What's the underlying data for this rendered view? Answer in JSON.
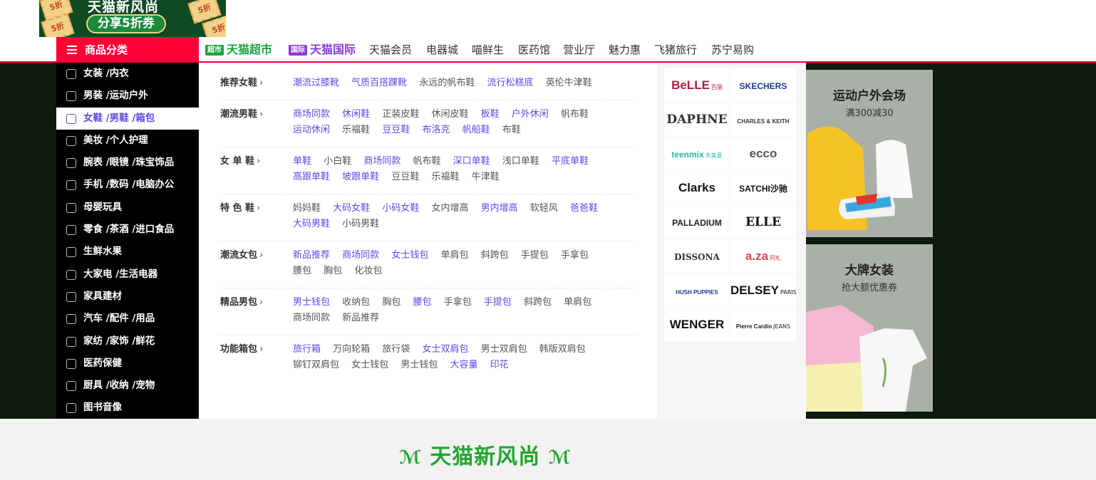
{
  "promo": {
    "title": "天猫新风尚",
    "coupon_text": "分享5折券",
    "coupon_badge": "5折"
  },
  "header": {
    "category_label": "商品分类",
    "nav": [
      {
        "label": "天猫超市",
        "badge": "超市",
        "color": "#1aa63d"
      },
      {
        "label": "天猫国际",
        "badge": "国际",
        "color": "#8d3bd8"
      },
      {
        "label": "天猫会员"
      },
      {
        "label": "电器城"
      },
      {
        "label": "喵鲜生"
      },
      {
        "label": "医药馆"
      },
      {
        "label": "营业厅"
      },
      {
        "label": "魅力惠"
      },
      {
        "label": "飞猪旅行"
      },
      {
        "label": "苏宁易购"
      }
    ]
  },
  "sidebar": {
    "items": [
      {
        "label": "女装 /内衣",
        "icon": "dress-icon"
      },
      {
        "label": "男装 /运动户外",
        "icon": "shirt-icon"
      },
      {
        "label": "女鞋 /男鞋 /箱包",
        "icon": "shoe-icon",
        "active": true
      },
      {
        "label": "美妆 /个人护理",
        "icon": "lipstick-icon"
      },
      {
        "label": "腕表 /眼镜 /珠宝饰品",
        "icon": "diamond-icon"
      },
      {
        "label": "手机 /数码 /电脑办公",
        "icon": "phone-icon"
      },
      {
        "label": "母婴玩具",
        "icon": "stroller-icon"
      },
      {
        "label": "零食 /茶酒 /进口食品",
        "icon": "food-icon"
      },
      {
        "label": "生鲜水果",
        "icon": "bike-icon"
      },
      {
        "label": "大家电 /生活电器",
        "icon": "fridge-icon"
      },
      {
        "label": "家具建材",
        "icon": "grid-icon"
      },
      {
        "label": "汽车 /配件 /用品",
        "icon": "car-icon"
      },
      {
        "label": "家纺 /家饰 /鲜花",
        "icon": "bed-icon"
      },
      {
        "label": "医药保健",
        "icon": "medicine-icon"
      },
      {
        "label": "厨具 /收纳 /宠物",
        "icon": "cup-icon"
      },
      {
        "label": "图书音像",
        "icon": "lock-icon"
      }
    ]
  },
  "categories": [
    {
      "title": "推荐女鞋",
      "links": [
        {
          "text": "潮流过膝靴",
          "hl": true
        },
        {
          "text": "气质百搭踝靴",
          "hl": true
        },
        {
          "text": "永远的帆布鞋"
        },
        {
          "text": "流行松糕底",
          "hl": true
        },
        {
          "text": "英伦牛津鞋"
        }
      ]
    },
    {
      "title": "潮流男鞋",
      "links": [
        {
          "text": "商场同款",
          "hl": true
        },
        {
          "text": "休闲鞋",
          "hl": true
        },
        {
          "text": "正装皮鞋"
        },
        {
          "text": "休闲皮鞋"
        },
        {
          "text": "板鞋",
          "hl": true
        },
        {
          "text": "户外休闲",
          "hl": true
        },
        {
          "text": "帆布鞋"
        },
        {
          "text": "运动休闲",
          "hl": true
        },
        {
          "text": "乐福鞋"
        },
        {
          "text": "豆豆鞋",
          "hl": true
        },
        {
          "text": "布洛克",
          "hl": true
        },
        {
          "text": "帆船鞋",
          "hl": true
        },
        {
          "text": "布鞋"
        }
      ]
    },
    {
      "title": "女 单 鞋",
      "links": [
        {
          "text": "单鞋",
          "hl": true
        },
        {
          "text": "小白鞋"
        },
        {
          "text": "商场同款",
          "hl": true
        },
        {
          "text": "帆布鞋"
        },
        {
          "text": "深口单鞋",
          "hl": true
        },
        {
          "text": "浅口单鞋"
        },
        {
          "text": "平底单鞋",
          "hl": true
        },
        {
          "text": "高跟单鞋",
          "hl": true
        },
        {
          "text": "坡跟单鞋",
          "hl": true
        },
        {
          "text": "豆豆鞋"
        },
        {
          "text": "乐福鞋"
        },
        {
          "text": "牛津鞋"
        }
      ]
    },
    {
      "title": "特 色 鞋",
      "links": [
        {
          "text": "妈妈鞋"
        },
        {
          "text": "大码女鞋",
          "hl": true
        },
        {
          "text": "小码女鞋",
          "hl": true
        },
        {
          "text": "女内增高"
        },
        {
          "text": "男内增高",
          "hl": true
        },
        {
          "text": "软轻风"
        },
        {
          "text": "爸爸鞋",
          "hl": true
        },
        {
          "text": "大码男鞋",
          "hl": true
        },
        {
          "text": "小码男鞋"
        }
      ]
    },
    {
      "title": "潮流女包",
      "links": [
        {
          "text": "新品推荐",
          "hl": true
        },
        {
          "text": "商场同款",
          "hl": true
        },
        {
          "text": "女士钱包",
          "hl": true
        },
        {
          "text": "单肩包"
        },
        {
          "text": "斜跨包"
        },
        {
          "text": "手提包"
        },
        {
          "text": "手拿包"
        },
        {
          "text": "腰包"
        },
        {
          "text": "胸包"
        },
        {
          "text": "化妆包"
        }
      ]
    },
    {
      "title": "精品男包",
      "links": [
        {
          "text": "男士钱包",
          "hl": true
        },
        {
          "text": "收纳包"
        },
        {
          "text": "胸包"
        },
        {
          "text": "腰包",
          "hl": true
        },
        {
          "text": "手拿包"
        },
        {
          "text": "手提包",
          "hl": true
        },
        {
          "text": "斜跨包"
        },
        {
          "text": "单肩包"
        },
        {
          "text": "商场同款"
        },
        {
          "text": "新品推荐"
        }
      ]
    },
    {
      "title": "功能箱包",
      "links": [
        {
          "text": "旅行箱",
          "hl": true
        },
        {
          "text": "万向轮箱"
        },
        {
          "text": "旅行袋"
        },
        {
          "text": "女士双肩包",
          "hl": true
        },
        {
          "text": "男士双肩包"
        },
        {
          "text": "韩版双肩包"
        },
        {
          "text": "铆钉双肩包"
        },
        {
          "text": "女士钱包"
        },
        {
          "text": "男士钱包"
        },
        {
          "text": "大容量",
          "hl": true
        },
        {
          "text": "印花",
          "hl": true
        }
      ]
    }
  ],
  "brands": [
    {
      "name": "BeLLE",
      "sub": "百丽",
      "color": "#b01c3a"
    },
    {
      "name": "SKECHERS",
      "color": "#1d3b8f"
    },
    {
      "name": "DAPHNE",
      "color": "#333"
    },
    {
      "name": "CHARLES & KEITH",
      "color": "#333"
    },
    {
      "name": "teenmix",
      "sub": "天美意",
      "color": "#2bb5a8"
    },
    {
      "name": "ecco",
      "color": "#555"
    },
    {
      "name": "Clarks",
      "color": "#111"
    },
    {
      "name": "SATCHI沙驰",
      "color": "#111"
    },
    {
      "name": "PALLADIUM",
      "color": "#222"
    },
    {
      "name": "ELLE",
      "color": "#111"
    },
    {
      "name": "DISSONA",
      "color": "#333"
    },
    {
      "name": "a.za",
      "sub": "阿札",
      "color": "#e0454f"
    },
    {
      "name": "HUSH PUPPIES",
      "color": "#1d3b8f"
    },
    {
      "name": "DELSEY",
      "sub": "PARIS",
      "color": "#111"
    },
    {
      "name": "WENGER",
      "color": "#111"
    },
    {
      "name": "Pierre Cardin",
      "sub": "JEANS",
      "color": "#222"
    }
  ],
  "ads": [
    {
      "title": "运动户外会场",
      "sub": "满300减30"
    },
    {
      "title": "大牌女装",
      "sub": "抢大额优惠券"
    }
  ],
  "footer": {
    "logo": "天猫新风尚"
  }
}
